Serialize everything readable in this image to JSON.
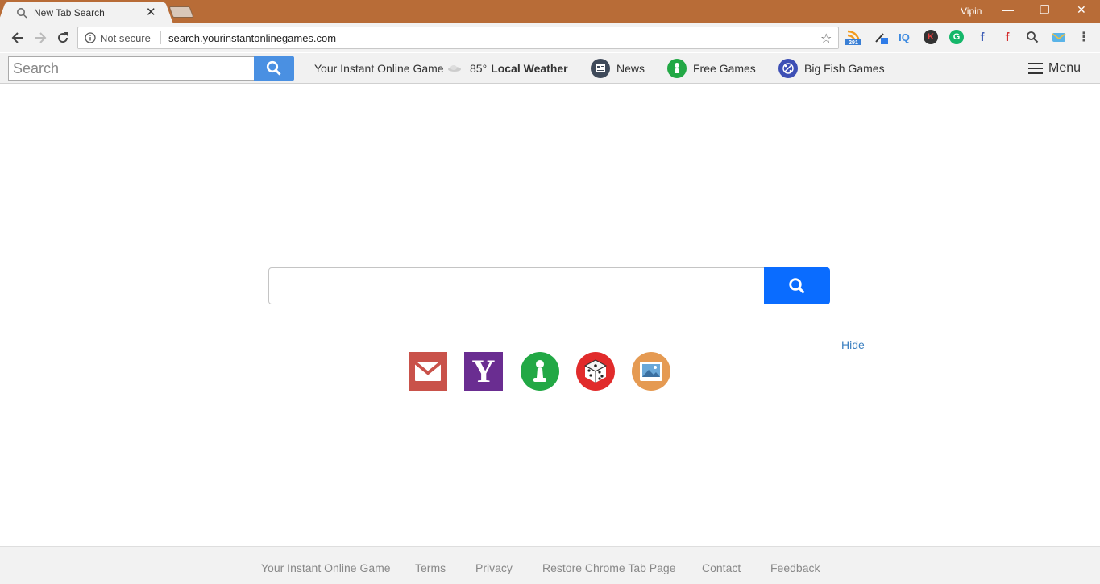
{
  "browser": {
    "tab_title": "New Tab Search",
    "profile_name": "Vipin",
    "security_label": "Not secure",
    "url": "search.yourinstantonlinegames.com",
    "extension_badge": "291"
  },
  "searchbar": {
    "placeholder": "Search",
    "site_link": "Your Instant Online Game",
    "weather_temp": "85°",
    "weather_label": "Local Weather",
    "news_label": "News",
    "free_games_label": "Free Games",
    "big_fish_label": "Big Fish Games",
    "menu_label": "Menu"
  },
  "main": {
    "hide_label": "Hide",
    "tiles": [
      "gmail-icon",
      "yahoo-icon",
      "pawn-icon",
      "dice-icon",
      "image-icon"
    ]
  },
  "footer": {
    "links": [
      "Your Instant Online Game",
      "Terms",
      "Privacy",
      "Restore Chrome Tab Page",
      "Contact",
      "Feedback"
    ]
  },
  "colors": {
    "titlebar": "#b86c37",
    "search_button": "#0a6cff",
    "toolbar_search_button": "#4a90e2",
    "hide_link": "#3a7fc0"
  }
}
